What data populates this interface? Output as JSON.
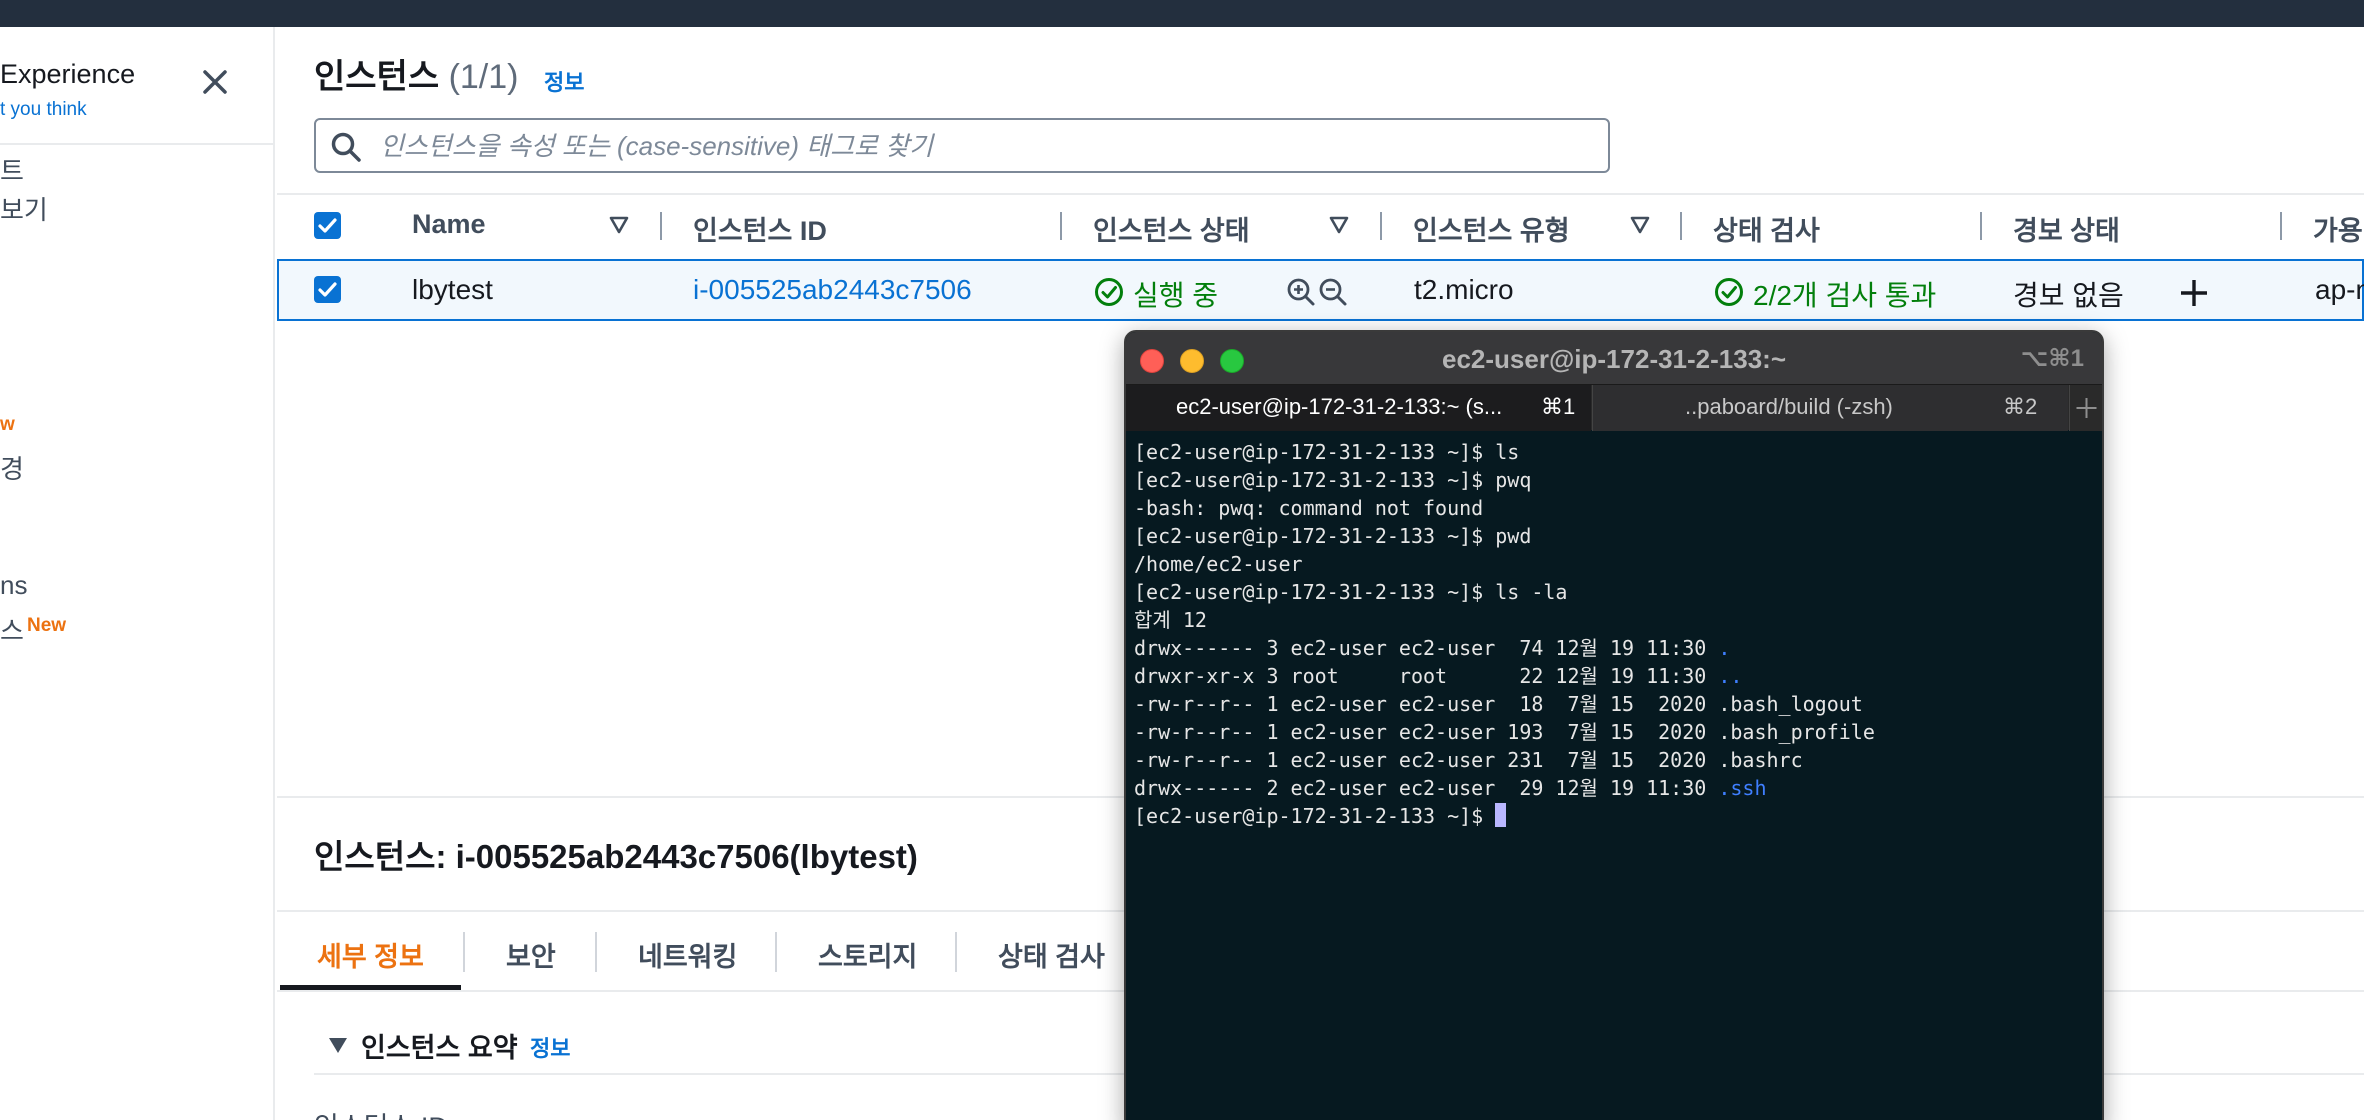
{
  "sidebar": {
    "title": "Experience",
    "link": "t you think",
    "items": [
      "트",
      "보기",
      "ns",
      "스"
    ],
    "fragment_w": "w",
    "fragment_gyeong": "경",
    "new_badge": "New"
  },
  "main": {
    "title": "인스턴스",
    "count": "(1/1)",
    "info_label": "정보",
    "search_placeholder": "인스턴스을 속성 또는 (case-sensitive) 태그로 찾기",
    "columns": [
      "Name",
      "인스턴스 ID",
      "인스턴스 상태",
      "인스턴스 유형",
      "상태 검사",
      "경보 상태",
      "가용 영역"
    ],
    "row": {
      "name": "lbytest",
      "instance_id": "i-005525ab2443c7506",
      "state": "실행 중",
      "type": "t2.micro",
      "status_check": "2/2개 검사 통과",
      "alarm": "경보 없음",
      "az": "ap-north"
    },
    "detail_title": "인스턴스: i-005525ab2443c7506(lbytest)",
    "tabs": [
      "세부 정보",
      "보안",
      "네트워킹",
      "스토리지",
      "상태 검사"
    ],
    "section_title": "인스턴스 요약",
    "field_label": "인스턴스 ID"
  },
  "terminal": {
    "title": "ec2-user@ip-172-31-2-133:~",
    "shortcut": "⌥⌘1",
    "tabs": [
      {
        "label": "ec2-user@ip-172-31-2-133:~ (s...",
        "key": "⌘1"
      },
      {
        "label": "..paboard/build (-zsh)",
        "key": "⌘2"
      }
    ],
    "new_tab": "+",
    "lines": [
      "[ec2-user@ip-172-31-2-133 ~]$ ls",
      "[ec2-user@ip-172-31-2-133 ~]$ pwq",
      "-bash: pwq: command not found",
      "[ec2-user@ip-172-31-2-133 ~]$ pwd",
      "/home/ec2-user",
      "[ec2-user@ip-172-31-2-133 ~]$ ls -la",
      "합계 12"
    ],
    "listing": [
      {
        "prefix": "drwx------ 3 ec2-user ec2-user  74 12월 19 11:30 ",
        "name": ".",
        "dir": true
      },
      {
        "prefix": "drwxr-xr-x 3 root     root      22 12월 19 11:30 ",
        "name": "..",
        "dir": true
      },
      {
        "prefix": "-rw-r--r-- 1 ec2-user ec2-user  18  7월 15  2020 ",
        "name": ".bash_logout",
        "dir": false
      },
      {
        "prefix": "-rw-r--r-- 1 ec2-user ec2-user 193  7월 15  2020 ",
        "name": ".bash_profile",
        "dir": false
      },
      {
        "prefix": "-rw-r--r-- 1 ec2-user ec2-user 231  7월 15  2020 ",
        "name": ".bashrc",
        "dir": false
      },
      {
        "prefix": "drwx------ 2 ec2-user ec2-user  29 12월 19 11:30 ",
        "name": ".ssh",
        "dir": true
      }
    ],
    "prompt": "[ec2-user@ip-172-31-2-133 ~]$ "
  },
  "colors": {
    "link": "#0972d3",
    "success": "#037f0c",
    "new_badge": "#ec7211",
    "terminal_bg": "#061920",
    "dir": "#3f7fff"
  }
}
